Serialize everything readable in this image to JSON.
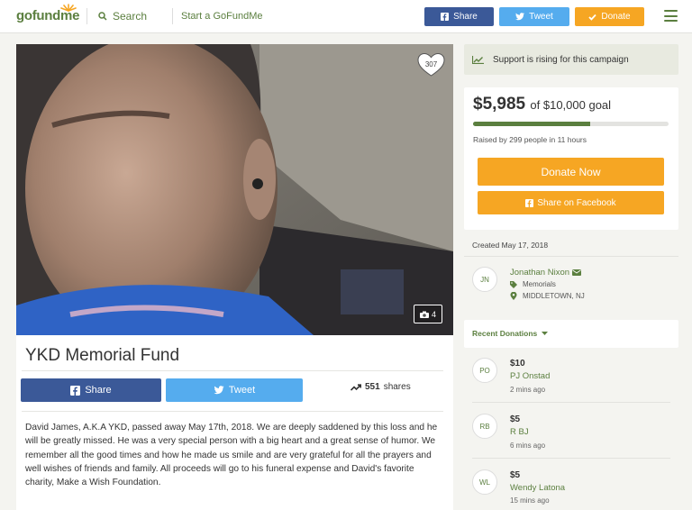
{
  "nav": {
    "logo_go": "go",
    "logo_fund": "fund",
    "logo_me": "me",
    "search_label": "Search",
    "start_label": "Start a GoFundMe",
    "share_label": "Share",
    "tweet_label": "Tweet",
    "donate_label": "Donate"
  },
  "hero": {
    "heart_count": "307",
    "photo_count": "4"
  },
  "campaign": {
    "title": "YKD Memorial Fund",
    "share_label": "Share",
    "tweet_label": "Tweet",
    "shares_count": "551",
    "shares_label": "shares",
    "story": "David James, A.K.A YKD, passed away May 17th, 2018. We are deeply saddened by this loss and he will be greatly missed. He was a very special person with a big heart and a great sense of humor. We remember all the good times and how he made us smile and are very grateful for all the prayers and well wishes of friends and family. All proceeds will go to his funeral expense and David's favorite charity, Make a Wish Foundation."
  },
  "sidebar": {
    "rising_text": "Support is rising for this campaign",
    "amount": "$5,985",
    "goal_text": "of $10,000 goal",
    "progress_fraction": 0.5985,
    "raised_text": "Raised by 299 people in 11 hours",
    "donate_now_label": "Donate Now",
    "fb_share_label": "Share on Facebook",
    "created": "Created May 17, 2018",
    "organizer": {
      "initials": "JN",
      "name": "Jonathan Nixon",
      "category": "Memorials",
      "location": "MIDDLETOWN, NJ"
    },
    "recent_title": "Recent Donations",
    "donations": [
      {
        "initials": "PO",
        "amount": "$10",
        "name": "PJ Onstad",
        "time": "2 mins ago"
      },
      {
        "initials": "RB",
        "amount": "$5",
        "name": "R BJ",
        "time": "6 mins ago"
      },
      {
        "initials": "WL",
        "amount": "$5",
        "name": "Wendy Latona",
        "time": "15 mins ago"
      }
    ]
  },
  "colors": {
    "brand_green": "#5b7f3f",
    "facebook_blue": "#3b5998",
    "twitter_blue": "#55acee",
    "donate_orange": "#f6a623"
  }
}
